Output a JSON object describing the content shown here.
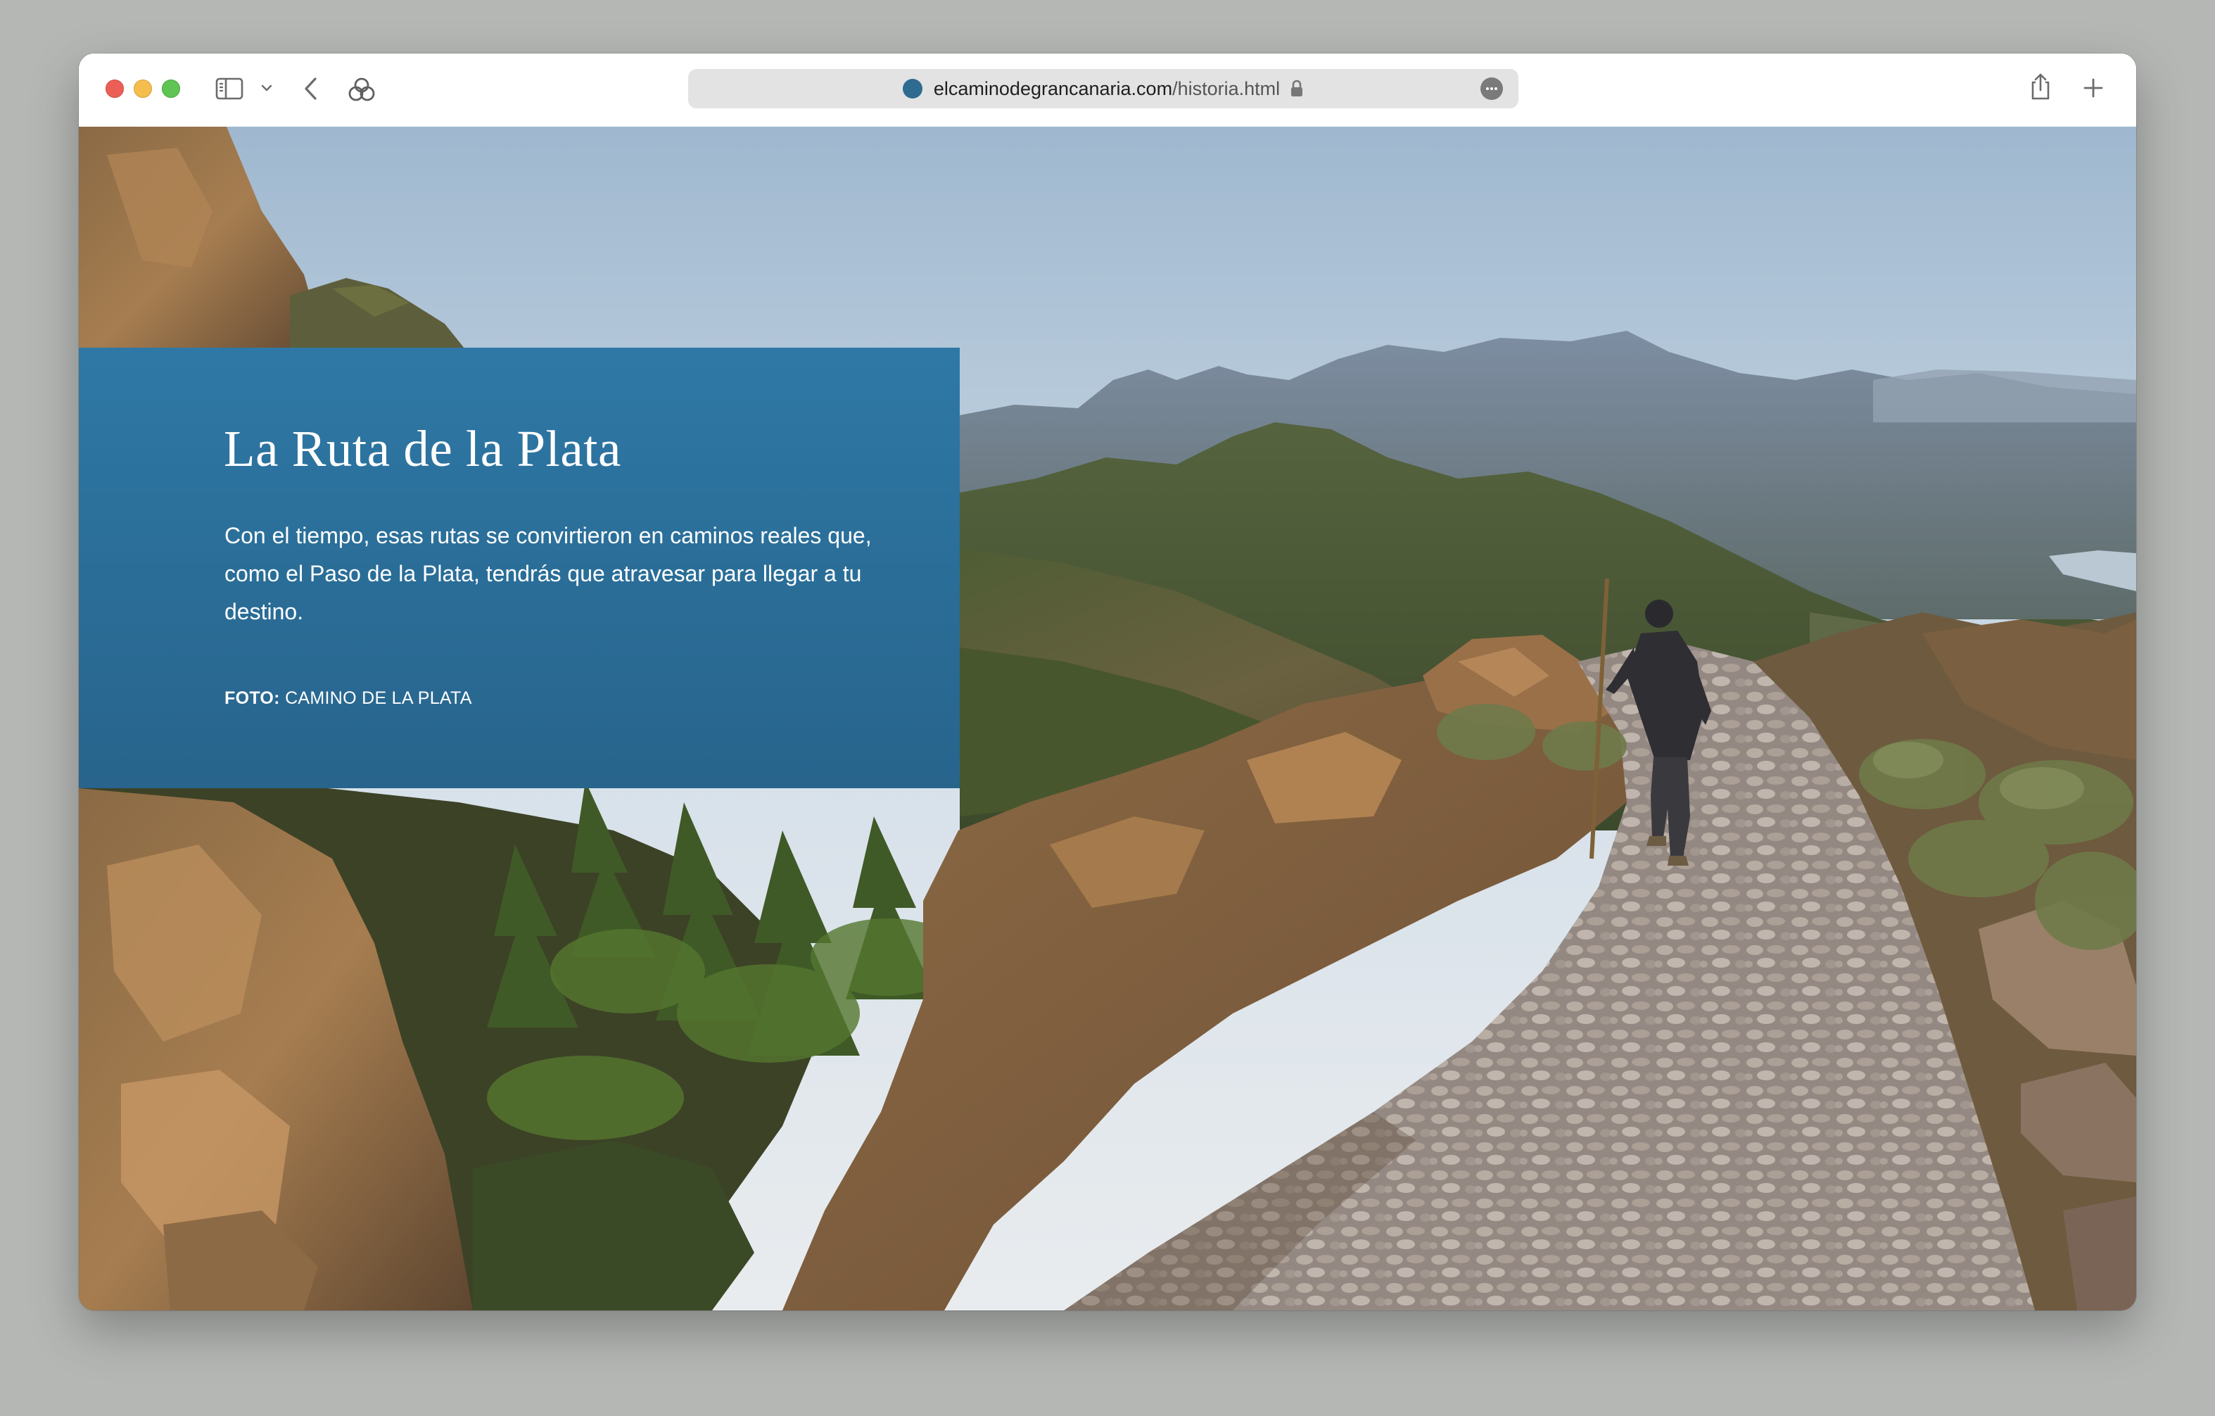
{
  "browser": {
    "url_domain": "elcaminodegrancanaria.com",
    "url_path": "/historia.html",
    "icons": [
      "sidebar-icon",
      "chevron-down-icon",
      "back-icon",
      "tab-group-icon",
      "lock-icon",
      "more-icon",
      "share-icon",
      "new-tab-icon"
    ]
  },
  "hero": {
    "title": "La Ruta de la Plata",
    "description": "Con el tiempo, esas rutas se convirtieron en caminos reales que, como el Paso de la Plata, tendrás que atravesar para llegar a tu destino.",
    "credit_label": "FOTO:",
    "credit_value": "CAMINO DE LA PLATA",
    "panel_color": "#2b6f9a"
  }
}
